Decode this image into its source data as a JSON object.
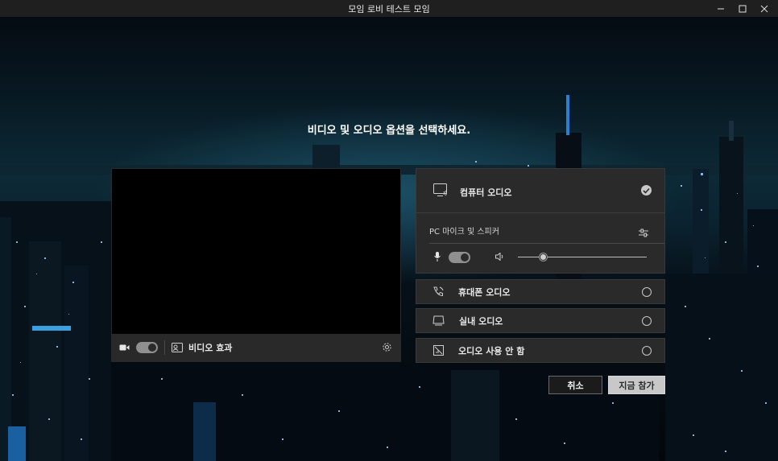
{
  "window": {
    "title": "모임 로비 테스트 모임",
    "controls": [
      "minimize-icon",
      "maximize-icon",
      "close-icon"
    ]
  },
  "headline": "비디오 및 오디오 옵션을 선택하세요.",
  "video": {
    "camera_on": true,
    "effects_label": "비디오 효과",
    "icons": [
      "camera-icon",
      "video-effects-icon",
      "settings-icon"
    ]
  },
  "audio": {
    "computer_audio": {
      "label": "컴퓨터 오디오",
      "selected": true,
      "device_label": "PC 마이크 및 스피커",
      "mic_on": true,
      "speaker_volume": 0.2
    },
    "options": [
      {
        "label": "휴대폰 오디오",
        "icon": "phone-audio-icon",
        "selected": false
      },
      {
        "label": "실내 오디오",
        "icon": "room-audio-icon",
        "selected": false
      },
      {
        "label": "오디오 사용 안 함",
        "icon": "no-audio-icon",
        "selected": false
      }
    ]
  },
  "buttons": {
    "cancel": "취소",
    "join_now": "지금 참가"
  },
  "colors": {
    "panel_bg": "#2a2a2a",
    "join_button_bg": "#c8c8c8",
    "cancel_button_bg": "#1b1b1b"
  }
}
